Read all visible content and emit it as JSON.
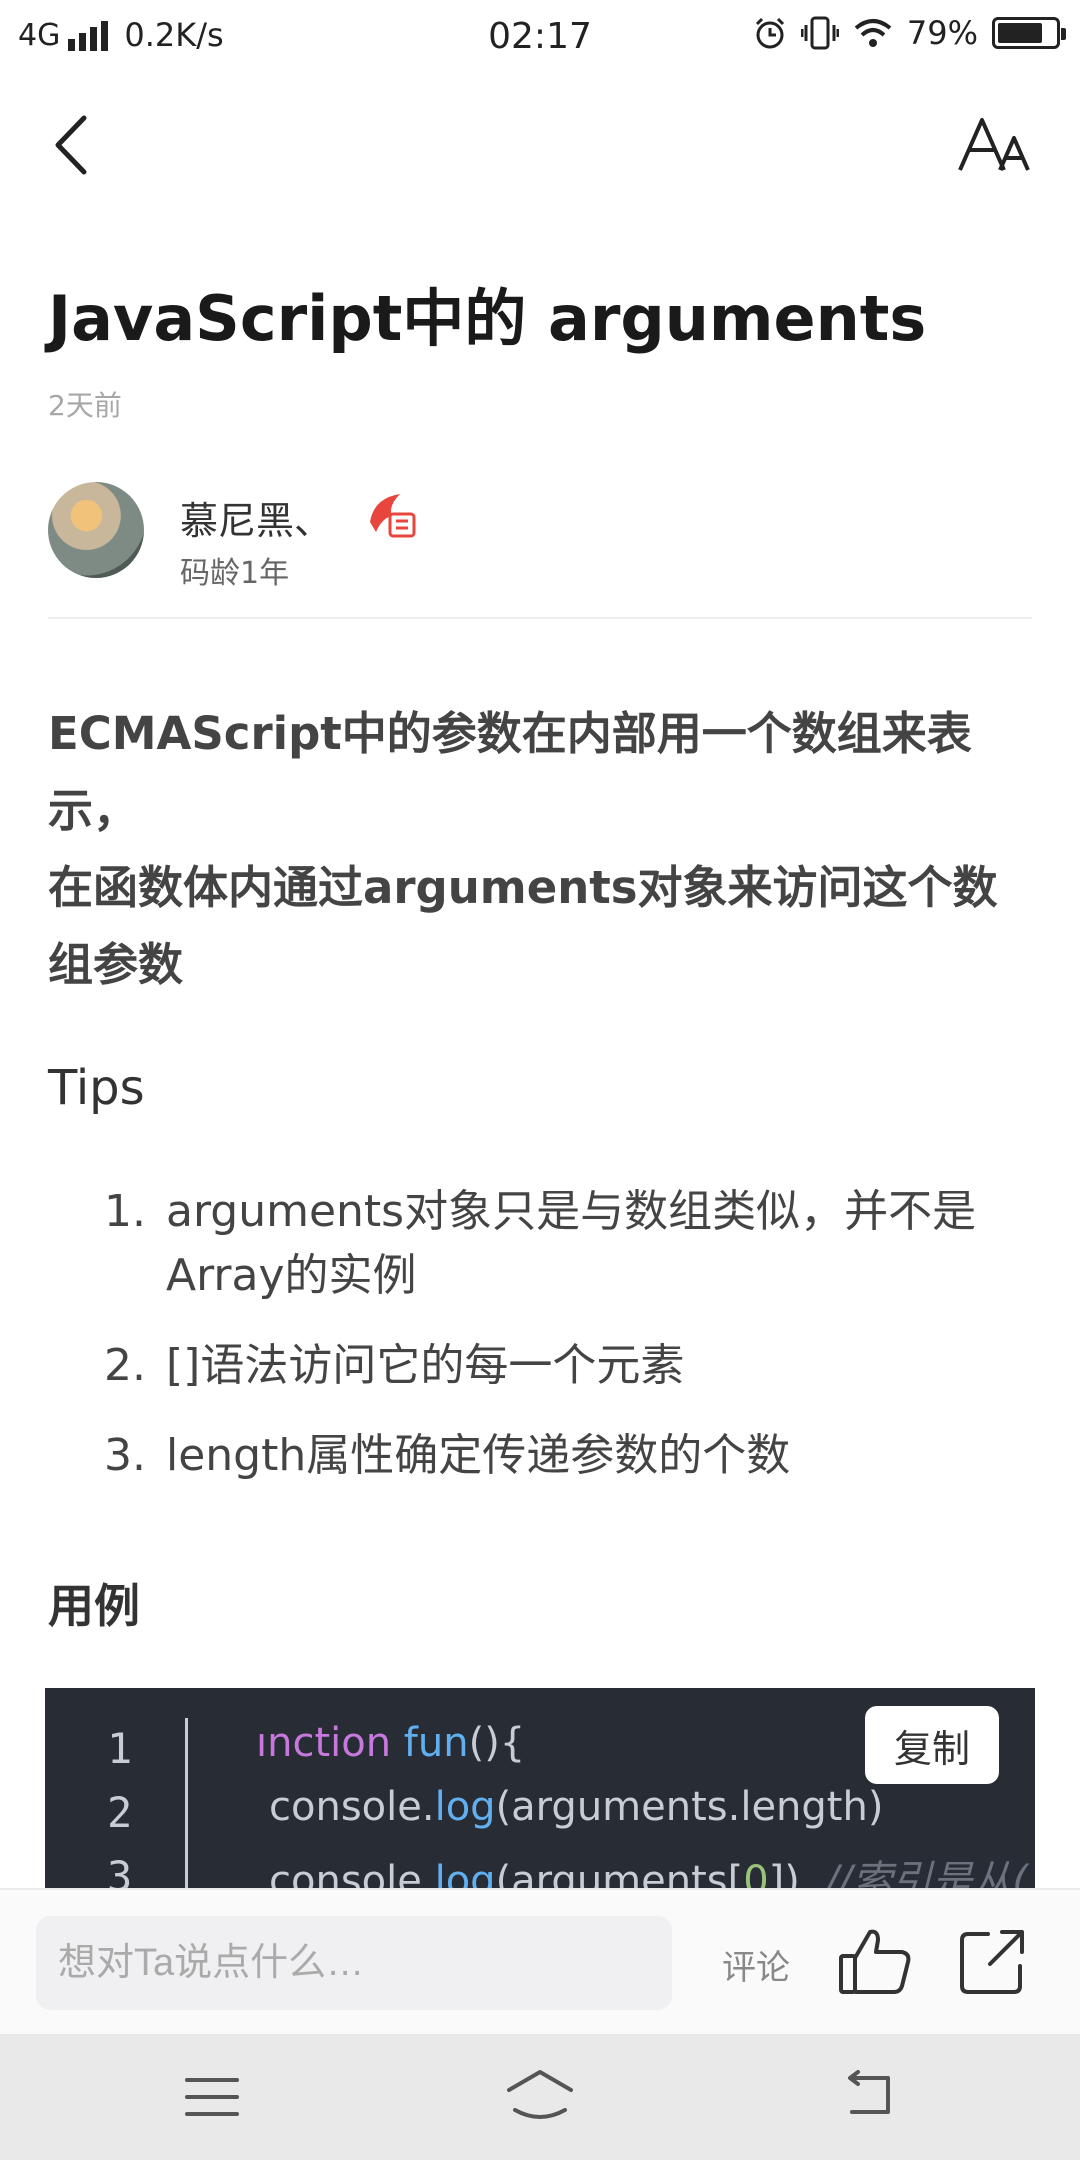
{
  "status_bar": {
    "network": "4G",
    "speed": "0.2K/s",
    "time": "02:17",
    "battery": "79%",
    "battery_level": 0.79
  },
  "article": {
    "title": "JavaScript中的 arguments",
    "date": "2天前",
    "author": {
      "name": "慕尼黑、",
      "coding_age": "码龄1年"
    },
    "lead_lines": [
      "ECMAScript中的参数在内部用一个数组来表示，",
      "在函数体内通过arguments对象来访问这个数组参数"
    ],
    "tips_heading": "Tips",
    "tips": [
      {
        "num": "1.",
        "text": "arguments对象只是与数组类似，并不是Array的实例"
      },
      {
        "num": "2.",
        "text": "[]语法访问它的每一个元素"
      },
      {
        "num": "3.",
        "text": "length属性确定传递参数的个数"
      }
    ],
    "example_heading": "用例",
    "code": {
      "line_numbers": [
        "1",
        "2",
        "3"
      ],
      "copy_label": "复制",
      "line1": {
        "kw": "ınction",
        "sp": " ",
        "fn": "fun",
        "rest": "(){"
      },
      "line2": {
        "a": "console.",
        "fn": "log",
        "b": "(arguments.length)"
      },
      "line3": {
        "a": "console.",
        "fn": "log",
        "b": "(arguments[",
        "num": "0",
        "c": "])",
        "comment": "//索引是从("
      }
    }
  },
  "bottom_bar": {
    "comment_placeholder": "想对Ta说点什么…",
    "comment_label": "评论"
  },
  "colors": {
    "code_bg": "#282c34",
    "keyword": "#c678dd",
    "function": "#61afef",
    "number": "#98c379"
  }
}
